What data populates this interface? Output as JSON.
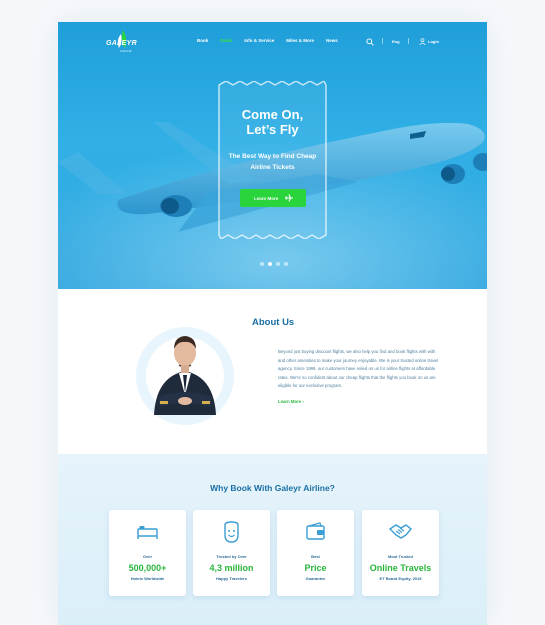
{
  "brand": {
    "name": "GALEYR",
    "tagline": "AIRLINE"
  },
  "nav": {
    "items": [
      "Book",
      "Deals",
      "Info & Service",
      "Miles & More",
      "News"
    ],
    "active_index": 1,
    "language": "Eng",
    "login": "Login"
  },
  "hero": {
    "title_line1": "Come On,",
    "title_line2": "Let’s Fly",
    "subtitle_line1": "The Best Way to Find Cheap",
    "subtitle_line2": "Airline Tickets",
    "button": "Learn More",
    "slides": 4,
    "active_slide": 1
  },
  "about": {
    "title": "About Us",
    "text": "Beyond just buying discount flights, we also help you find and book flights with with and other amenities to make your journey enjoyable. We is your trusted online travel agency. Since 1999, our customers have relied on us for airline flights at affordable rates. We're so confident about our cheap flights that the flights you book on us are eligible for our exclusive program.",
    "link": "Learn More  ›"
  },
  "why": {
    "title": "Why Book With Galeyr Airline?",
    "cards": [
      {
        "icon": "bed-icon",
        "over": "Over",
        "big": "500,000+",
        "small": "Hotels Worldwide"
      },
      {
        "icon": "smiley-icon",
        "over": "Trusted by Over",
        "big": "4,3 million",
        "small": "Happy Travelers"
      },
      {
        "icon": "wallet-icon",
        "over": "Best",
        "big": "Price",
        "small": "Guarantee"
      },
      {
        "icon": "handshake-icon",
        "over": "Most Trusted",
        "big": "Online Travels",
        "small": "ET Brand Equity, 2015"
      }
    ]
  },
  "colors": {
    "hero_blue": "#2aa8e0",
    "accent_green": "#2ad43c",
    "heading_blue": "#1a6fa3",
    "text_blue": "#4d7e9e"
  }
}
